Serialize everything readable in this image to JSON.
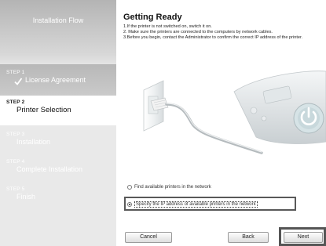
{
  "sidebar": {
    "header": "Installation Flow",
    "steps": [
      {
        "num": "STEP 1",
        "name": "License Agreement",
        "state": "completed"
      },
      {
        "num": "STEP 2",
        "name": "Printer Selection",
        "state": "active"
      },
      {
        "num": "STEP 3",
        "name": "Installation",
        "state": "pending"
      },
      {
        "num": "STEP 4",
        "name": "Complete Installation",
        "state": "pending"
      },
      {
        "num": "STEP 5",
        "name": "Finish",
        "state": "pending"
      }
    ]
  },
  "main": {
    "title": "Getting Ready",
    "instructions": [
      "1.If the printer is not switched on, switch it on.",
      "2. Make sure the printers are connected to the computers by network cables.",
      "3.Before you begin, contact the Administrator to confirm the correct IP address of the printer."
    ],
    "options": [
      {
        "label": "Find available printers in the network",
        "selected": false
      },
      {
        "label": "Specify the IP address of available printers in the network",
        "selected": true
      }
    ],
    "buttons": {
      "cancel": "Cancel",
      "back": "Back",
      "next": "Next"
    }
  },
  "colors": {
    "sidebar_bg": "#e9e9e9",
    "active_step_bg": "#ffffff",
    "highlight_border": "#595959",
    "power_icon": "#d6e3e6"
  },
  "icons": {
    "completed_step": "checkmark-icon",
    "illustration": "network-cable-plug-and-power-button-illustration"
  }
}
